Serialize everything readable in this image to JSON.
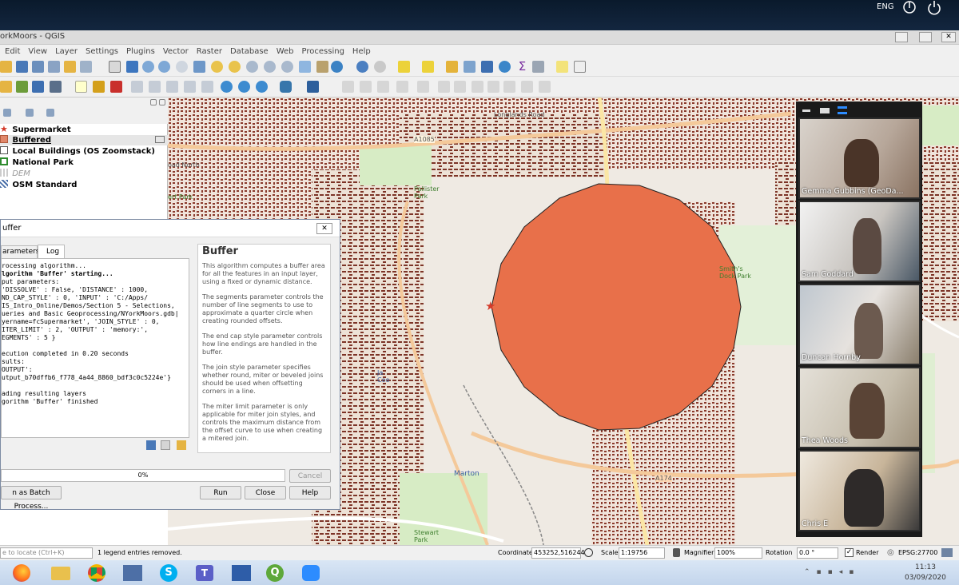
{
  "os": {
    "lang": "ENG"
  },
  "window": {
    "title": "orkMoors - QGIS"
  },
  "menu": [
    "Edit",
    "View",
    "Layer",
    "Settings",
    "Plugins",
    "Vector",
    "Raster",
    "Database",
    "Web",
    "Processing",
    "Help"
  ],
  "layers": [
    {
      "name": "Supermarket",
      "icon": "star-icon"
    },
    {
      "name": "Buffered",
      "icon": "polygon-fill-icon"
    },
    {
      "name": "Local Buildings (OS Zoomstack)",
      "icon": "polygon-empty-icon"
    },
    {
      "name": "National Park",
      "icon": "polygon-green-icon"
    },
    {
      "name": "DEM",
      "icon": "raster-icon"
    },
    {
      "name": "OSM Standard",
      "icon": "tile-icon"
    }
  ],
  "dialog": {
    "title": "uffer",
    "tabs": [
      "arameters",
      "Log"
    ],
    "log": [
      "rocessing algorithm...",
      "lgorithm 'Buffer' starting...",
      "put parameters:",
      "'DISSOLVE' : False, 'DISTANCE' : 1000,",
      "ND_CAP_STYLE' : 0, 'INPUT' : 'C:/Apps/",
      "IS_Intro_Online/Demos/Section 5 - Selections,",
      "ueries and Basic Geoprocessing/NYorkMoors.gdb|",
      "yername=fcSupermarket', 'JOIN_STYLE' : 0,",
      "ITER_LIMIT' : 2, 'OUTPUT' : 'memory:',",
      "EGMENTS' : 5 }",
      "",
      "ecution completed in 0.20 seconds",
      "sults:",
      "OUTPUT':",
      "utput_b70dffb6_f778_4a44_8860_bdf3c0c5224e'}",
      "",
      "ading resulting layers",
      "gorithm 'Buffer' finished"
    ],
    "help_title": "Buffer",
    "help": [
      "This algorithm computes a buffer area for all the features in an input layer, using a fixed or dynamic distance.",
      "The segments parameter controls the number of line segments to use to approximate a quarter circle when creating rounded offsets.",
      "The end cap style parameter controls how line endings are handled in the buffer.",
      "The join style parameter specifies whether round, miter or beveled joins should be used when offsetting corners in a line.",
      "The miter limit parameter is only applicable for miter join styles, and controls the maximum distance from the offset curve to use when creating a mitered join."
    ],
    "progress": "0%",
    "progress_value": 0,
    "cancel": "Cancel",
    "batch": "n as Batch Process...",
    "run": "Run",
    "close": "Close",
    "help_btn": "Help"
  },
  "map_labels": [
    "A1085",
    "Longlands Road",
    "Pallister Park",
    "Smith's Dock Park",
    "oad North",
    "ert Park",
    "A174",
    "Marton",
    "Stewart Park",
    "Ja Coo"
  ],
  "participants": [
    "Gemma Gubbins (GeoDa...",
    "Sam Goddard",
    "Duncan Hornby",
    "Thea Woods",
    "Chris E"
  ],
  "status": {
    "locate": "e to locate (Ctrl+K)",
    "message": "1 legend entries removed.",
    "coord_label": "Coordinate",
    "coord": "453252,516244",
    "scale_label": "Scale",
    "scale": "1:19756",
    "magnifier_label": "Magnifier",
    "magnifier": "100%",
    "rotation_label": "Rotation",
    "rotation": "0.0 °",
    "render": "Render",
    "crs": "EPSG:27700"
  },
  "clock": {
    "time": "11:13",
    "date": "03/09/2020"
  },
  "colors": {
    "buffer": "#e8704a",
    "star": "#d43b2a",
    "accent": "#2a6fbf"
  }
}
